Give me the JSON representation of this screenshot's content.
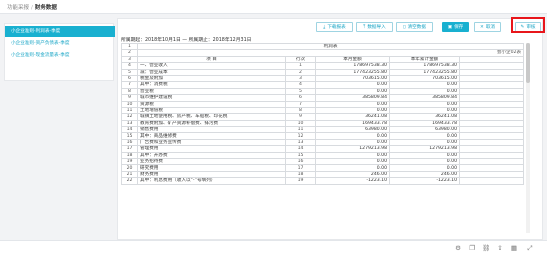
{
  "breadcrumb": {
    "parent": "功能采报",
    "separator": "/",
    "current": "财务数据"
  },
  "sidebar": {
    "items": [
      {
        "label": "小企业准则-利润表-季度"
      },
      {
        "label": "小企业准则-资产负债表-季度"
      },
      {
        "label": "小企业准则-现金流量表-季度"
      }
    ]
  },
  "toolbar": {
    "download": "下载报表",
    "import": "数据导入",
    "clear": "清空数据",
    "save": "保存",
    "cancel": "取消",
    "audit": "审核"
  },
  "period": {
    "label_start": "所属期起：",
    "start": "2018年10月1日",
    "label_end": "所属期止：",
    "end": "2018年12月31日"
  },
  "report": {
    "title": "利润表",
    "unit": "会小企02表",
    "header": {
      "item": "项 目",
      "line": "行次",
      "current": "本月金额",
      "ytd": "本年累计金额"
    },
    "rows": [
      {
        "n": "4",
        "item": "一、营业收入",
        "line": "1",
        "cur": "178697538.30",
        "ytd": "178697538.30"
      },
      {
        "n": "5",
        "item": "减：营业成本",
        "line": "2",
        "cur": "177423255.80",
        "ytd": "177423255.80"
      },
      {
        "n": "6",
        "item": "税金及附加",
        "line": "3",
        "cur": "703615.00",
        "ytd": "703615.00"
      },
      {
        "n": "7",
        "item": "其中：消费税",
        "line": "4",
        "cur": "0.00",
        "ytd": "0.00"
      },
      {
        "n": "8",
        "item": "营业税",
        "line": "5",
        "cur": "0.00",
        "ytd": "0.00"
      },
      {
        "n": "9",
        "item": "城市维护建设税",
        "line": "6",
        "cur": "385809.84",
        "ytd": "385809.84"
      },
      {
        "n": "10",
        "item": "资源税",
        "line": "7",
        "cur": "0.00",
        "ytd": "0.00"
      },
      {
        "n": "11",
        "item": "土地增值税",
        "line": "8",
        "cur": "0.00",
        "ytd": "0.00"
      },
      {
        "n": "12",
        "item": "城镇土地使用税、房产税、车船税、印花税",
        "line": "9",
        "cur": "36241.08",
        "ytd": "36241.08"
      },
      {
        "n": "13",
        "item": "教育费附加、矿产资源补偿费、排污费",
        "line": "10",
        "cur": "169433.78",
        "ytd": "169433.78"
      },
      {
        "n": "14",
        "item": "销售费用",
        "line": "11",
        "cur": "63980.00",
        "ytd": "63980.00"
      },
      {
        "n": "15",
        "item": "其中：商品维修费",
        "line": "12",
        "cur": "0.00",
        "ytd": "0.00"
      },
      {
        "n": "16",
        "item": "广告费和业务宣传费",
        "line": "13",
        "cur": "0.00",
        "ytd": "0.00"
      },
      {
        "n": "17",
        "item": "管理费用",
        "line": "14",
        "cur": "1279213.98",
        "ytd": "1279213.98"
      },
      {
        "n": "18",
        "item": "其中：开办费",
        "line": "15",
        "cur": "0.00",
        "ytd": "0.00"
      },
      {
        "n": "19",
        "item": "业务招待费",
        "line": "16",
        "cur": "0.00",
        "ytd": "0.00"
      },
      {
        "n": "20",
        "item": "研究费用",
        "line": "17",
        "cur": "0.00",
        "ytd": "0.00"
      },
      {
        "n": "21",
        "item": "财务费用",
        "line": "18",
        "cur": "246.00",
        "ytd": "246.00"
      },
      {
        "n": "22",
        "item": "其中：利息费用（收入以“-”号填列）",
        "line": "19",
        "cur": "-1223.10",
        "ytd": "-1223.10"
      }
    ]
  },
  "statusbar": {
    "icons": [
      "settings-icon",
      "copy-icon",
      "link-icon",
      "share-icon",
      "grid-icon",
      "expand-icon"
    ]
  }
}
